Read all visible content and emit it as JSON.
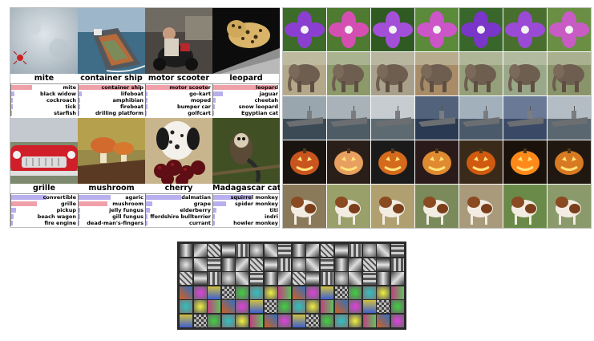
{
  "figure": {
    "left_panel": {
      "examples": [
        {
          "truth": "mite",
          "photo_icon": "mite-photo",
          "predictions": [
            {
              "label": "mite",
              "score": 0.32,
              "color": "#f0a0a8"
            },
            {
              "label": "black widow",
              "score": 0.05,
              "color": "#b8b0ee"
            },
            {
              "label": "cockroach",
              "score": 0.03,
              "color": "#b8b0ee"
            },
            {
              "label": "tick",
              "score": 0.02,
              "color": "#b8b0ee"
            },
            {
              "label": "starfish",
              "score": 0.01,
              "color": "#b8b0ee"
            }
          ]
        },
        {
          "truth": "container ship",
          "photo_icon": "container-ship-photo",
          "predictions": [
            {
              "label": "container ship",
              "score": 0.98,
              "color": "#f0a0a8"
            },
            {
              "label": "lifeboat",
              "score": 0.05,
              "color": "#b8b0ee"
            },
            {
              "label": "amphibian",
              "score": 0.03,
              "color": "#b8b0ee"
            },
            {
              "label": "fireboat",
              "score": 0.02,
              "color": "#b8b0ee"
            },
            {
              "label": "drilling platform",
              "score": 0.01,
              "color": "#b8b0ee"
            }
          ]
        },
        {
          "truth": "motor scooter",
          "photo_icon": "motor-scooter-photo",
          "predictions": [
            {
              "label": "motor scooter",
              "score": 0.98,
              "color": "#f0a0a8"
            },
            {
              "label": "go-kart",
              "score": 0.03,
              "color": "#b8b0ee"
            },
            {
              "label": "moped",
              "score": 0.02,
              "color": "#b8b0ee"
            },
            {
              "label": "bumper car",
              "score": 0.02,
              "color": "#b8b0ee"
            },
            {
              "label": "golfcart",
              "score": 0.01,
              "color": "#b8b0ee"
            }
          ]
        },
        {
          "truth": "leopard",
          "photo_icon": "leopard-photo",
          "predictions": [
            {
              "label": "leopard",
              "score": 0.98,
              "color": "#f0a0a8"
            },
            {
              "label": "jaguar",
              "score": 0.15,
              "color": "#b8b0ee"
            },
            {
              "label": "cheetah",
              "score": 0.04,
              "color": "#b8b0ee"
            },
            {
              "label": "snow leopard",
              "score": 0.02,
              "color": "#b8b0ee"
            },
            {
              "label": "Egyptian cat",
              "score": 0.01,
              "color": "#b8b0ee"
            }
          ]
        },
        {
          "truth": "grille",
          "photo_icon": "convertible-car-photo",
          "predictions": [
            {
              "label": "convertible",
              "score": 0.55,
              "color": "#b8b0ee"
            },
            {
              "label": "grille",
              "score": 0.4,
              "color": "#f0a0a8"
            },
            {
              "label": "pickup",
              "score": 0.08,
              "color": "#b8b0ee"
            },
            {
              "label": "beach wagon",
              "score": 0.04,
              "color": "#b8b0ee"
            },
            {
              "label": "fire engine",
              "score": 0.02,
              "color": "#b8b0ee"
            }
          ]
        },
        {
          "truth": "mushroom",
          "photo_icon": "mushroom-photo",
          "predictions": [
            {
              "label": "agaric",
              "score": 0.5,
              "color": "#b8b0ee"
            },
            {
              "label": "mushroom",
              "score": 0.45,
              "color": "#f0a0a8"
            },
            {
              "label": "jelly fungus",
              "score": 0.03,
              "color": "#b8b0ee"
            },
            {
              "label": "gill fungus",
              "score": 0.02,
              "color": "#b8b0ee"
            },
            {
              "label": "dead-man's-fingers",
              "score": 0.01,
              "color": "#b8b0ee"
            }
          ]
        },
        {
          "truth": "cherry",
          "photo_icon": "dalmatian-cherry-photo",
          "predictions": [
            {
              "label": "dalmatian",
              "score": 0.55,
              "color": "#b8b0ee"
            },
            {
              "label": "grape",
              "score": 0.1,
              "color": "#b8b0ee"
            },
            {
              "label": "elderberry",
              "score": 0.06,
              "color": "#b8b0ee"
            },
            {
              "label": "ffordshire bullterrier",
              "score": 0.03,
              "color": "#b8b0ee"
            },
            {
              "label": "currant",
              "score": 0.02,
              "color": "#b8b0ee"
            }
          ]
        },
        {
          "truth": "Madagascar cat",
          "photo_icon": "lemur-photo",
          "predictions": [
            {
              "label": "squirrel monkey",
              "score": 0.6,
              "color": "#b8b0ee"
            },
            {
              "label": "spider monkey",
              "score": 0.2,
              "color": "#b8b0ee"
            },
            {
              "label": "titi",
              "score": 0.05,
              "color": "#b8b0ee"
            },
            {
              "label": "indri",
              "score": 0.03,
              "color": "#b8b0ee"
            },
            {
              "label": "howler monkey",
              "score": 0.02,
              "color": "#b8b0ee"
            }
          ]
        }
      ]
    },
    "right_panel": {
      "rows": [
        {
          "subject": "purple-flower-photo",
          "count": 7
        },
        {
          "subject": "elephant-photo",
          "count": 7
        },
        {
          "subject": "aircraft-carrier-photo",
          "count": 7
        },
        {
          "subject": "jack-o-lantern-photo",
          "count": 7
        },
        {
          "subject": "dog-photo",
          "count": 7
        }
      ]
    },
    "kernels_panel": {
      "icon": "convolution-kernels-grid",
      "rows": 6,
      "cols": 16
    }
  }
}
